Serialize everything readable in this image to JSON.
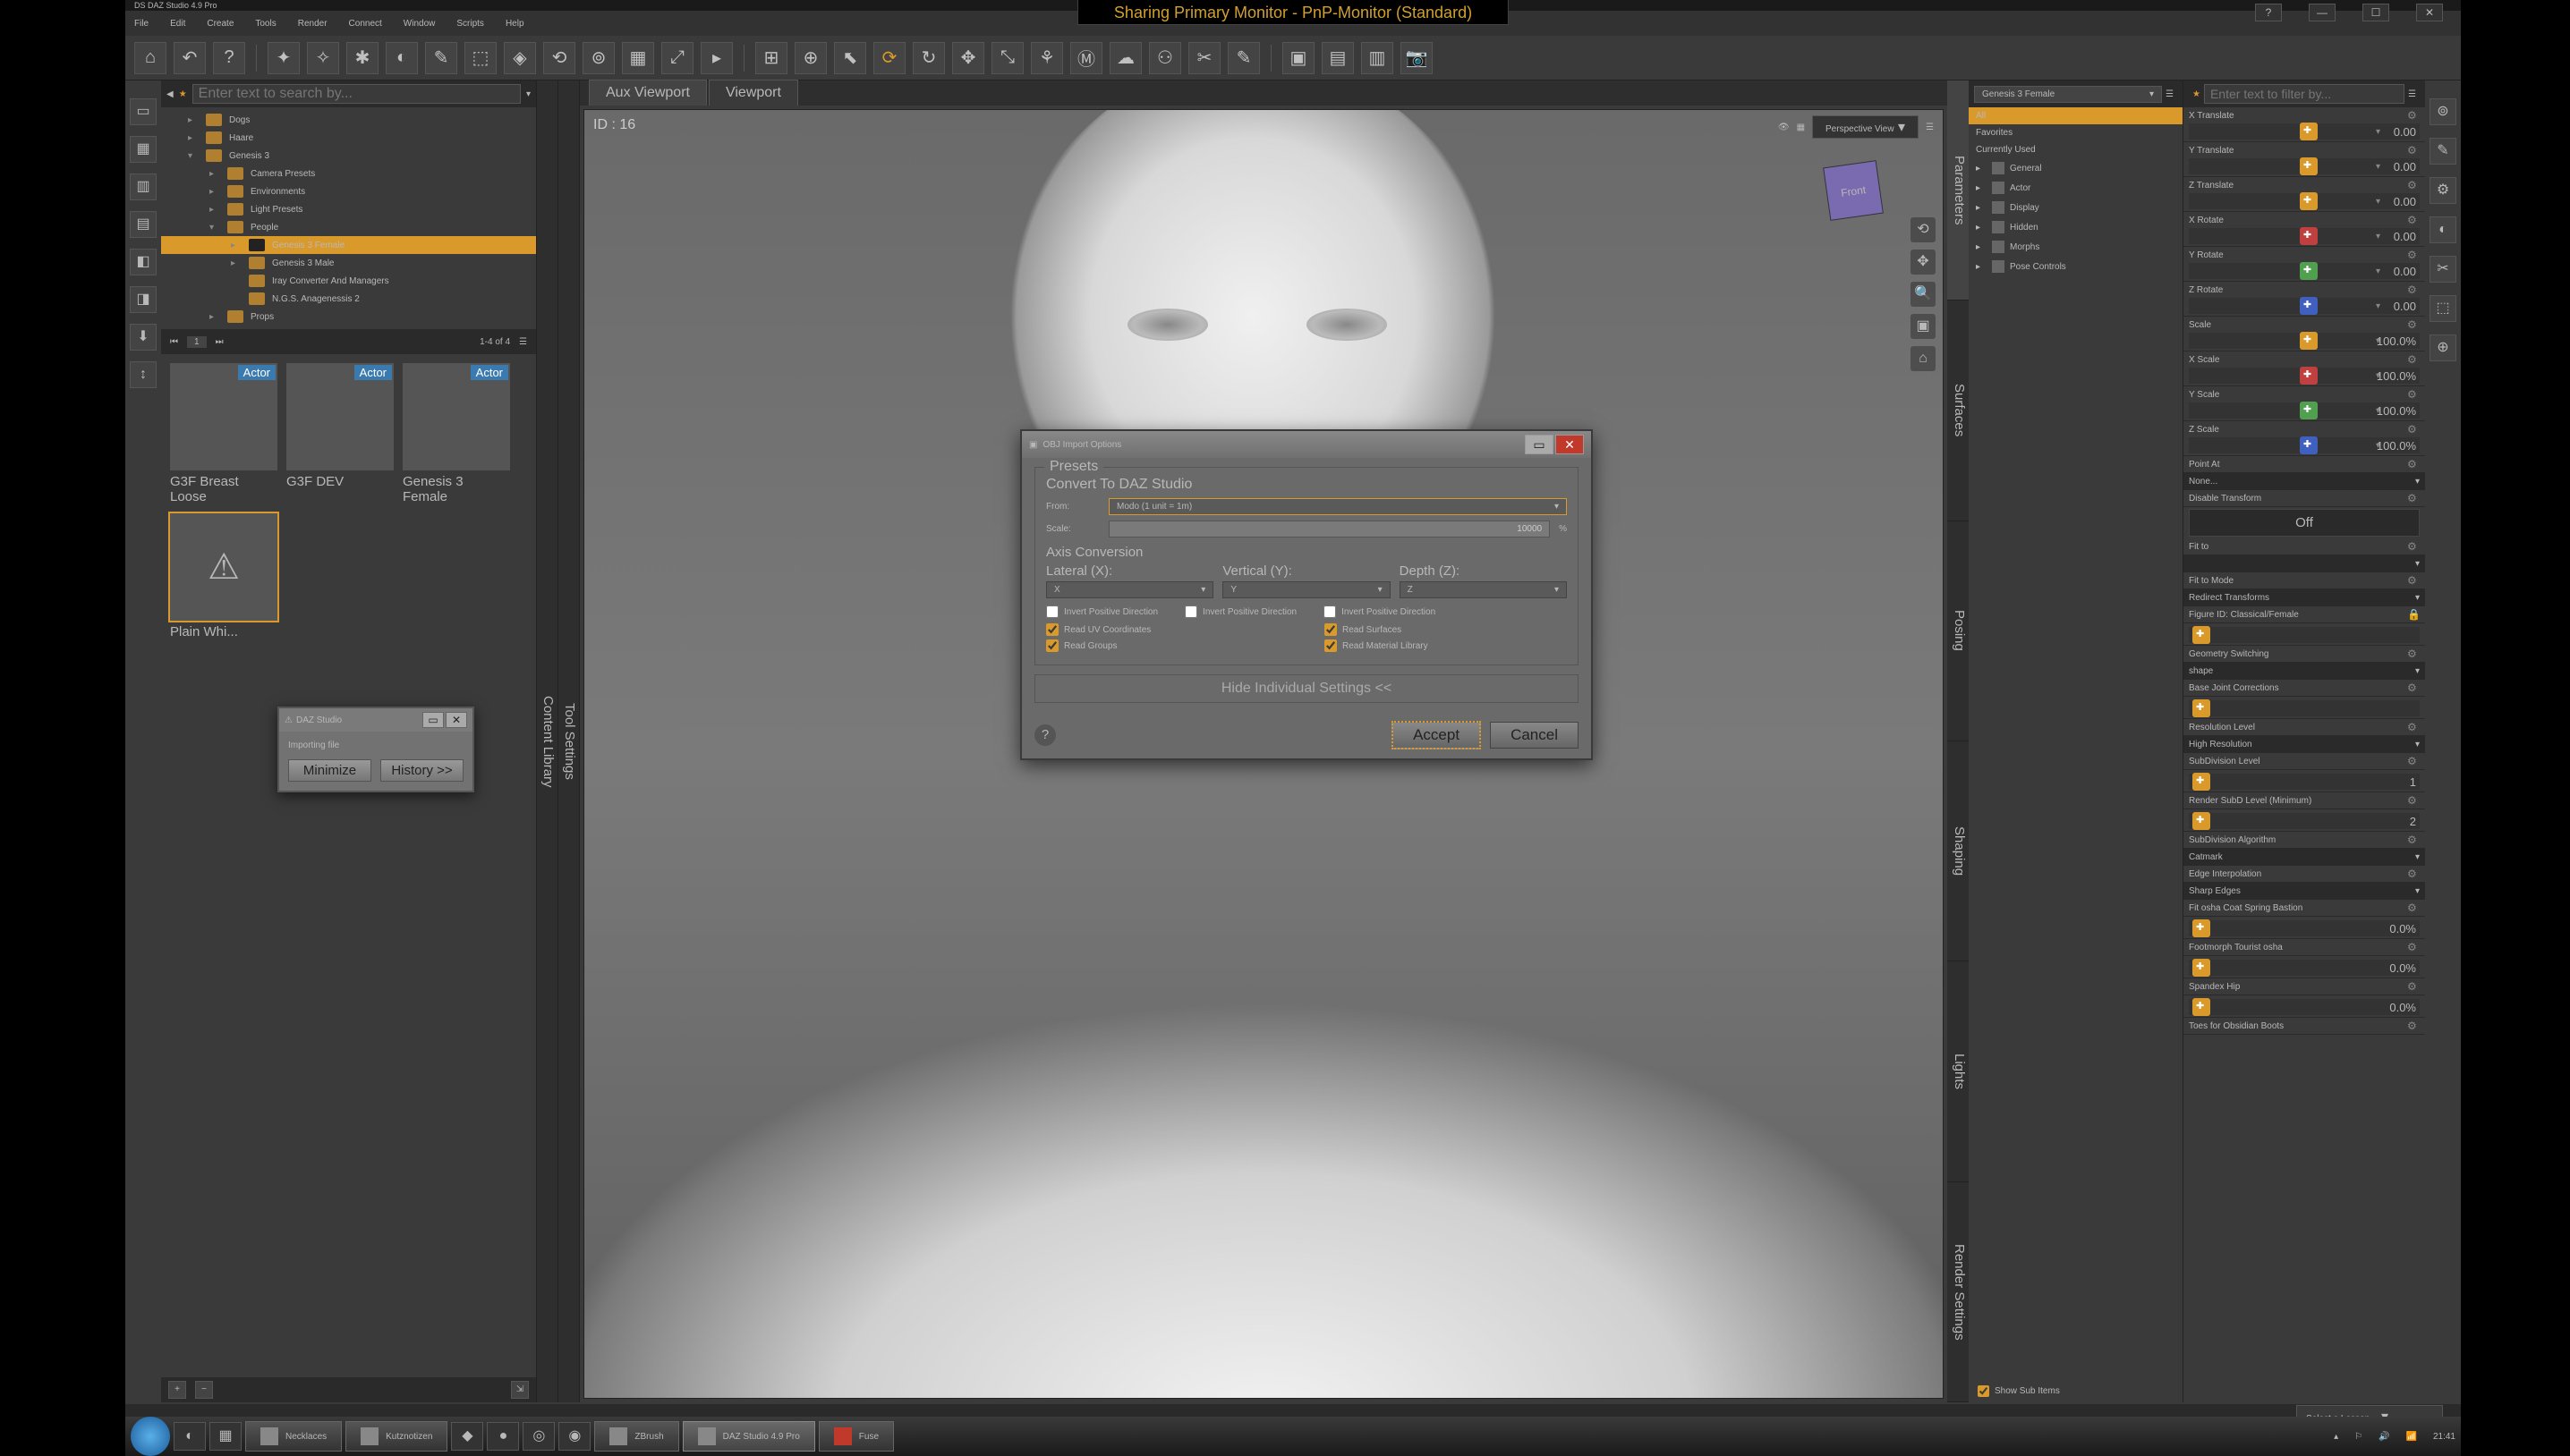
{
  "titlebar": "DS  DAZ Studio 4.9 Pro",
  "share_banner": "Sharing Primary Monitor - PnP-Monitor (Standard)",
  "menu": [
    "File",
    "Edit",
    "Create",
    "Tools",
    "Render",
    "Connect",
    "Window",
    "Scripts",
    "Help"
  ],
  "content": {
    "filter_placeholder": "Enter text to search by...",
    "tree": [
      {
        "label": "Dogs",
        "ind": 1,
        "arr": "▸"
      },
      {
        "label": "Haare",
        "ind": 1,
        "arr": "▸"
      },
      {
        "label": "Genesis 3",
        "ind": 1,
        "arr": "▾"
      },
      {
        "label": "Camera Presets",
        "ind": 2,
        "arr": "▸"
      },
      {
        "label": "Environments",
        "ind": 2,
        "arr": "▸"
      },
      {
        "label": "Light Presets",
        "ind": 2,
        "arr": "▸"
      },
      {
        "label": "People",
        "ind": 2,
        "arr": "▾"
      },
      {
        "label": "Genesis 3 Female",
        "ind": 3,
        "arr": "▸",
        "sel": true
      },
      {
        "label": "Genesis 3 Male",
        "ind": 3,
        "arr": "▸"
      },
      {
        "label": "Iray Converter And Managers",
        "ind": 3,
        "arr": ""
      },
      {
        "label": "N.G.S. Anagenessis 2",
        "ind": 3,
        "arr": ""
      },
      {
        "label": "Props",
        "ind": 2,
        "arr": "▸"
      }
    ],
    "thumbs_count": "1-4 of 4",
    "thumbs": [
      {
        "label": "G3F Breast Loose",
        "badge": "Actor"
      },
      {
        "label": "G3F DEV",
        "badge": "Actor"
      },
      {
        "label": "Genesis 3 Female",
        "badge": "Actor"
      },
      {
        "label": "Plain Whi...",
        "badge": "",
        "sel": true,
        "warn": true
      }
    ]
  },
  "side_tabs_left": [
    "Content Library",
    "Tool Settings",
    "Parameters"
  ],
  "viewport": {
    "tabs": [
      "Aux Viewport",
      "Viewport"
    ],
    "active_tab": 1,
    "hud_tl": "ID : 16",
    "camera_label": "Perspective View",
    "cube": "Front"
  },
  "side_tabs_right": [
    "Parameters",
    "Surfaces",
    "Posing",
    "Shaping",
    "Lights",
    "Render Settings"
  ],
  "scene": {
    "dropdown": "Genesis 3 Female",
    "rows": [
      {
        "label": "All",
        "hdr": true
      },
      {
        "label": "Favorites"
      },
      {
        "label": "Currently Used"
      },
      {
        "label": "General",
        "ico": "G"
      },
      {
        "label": "Actor",
        "ico": "👤"
      },
      {
        "label": "Display",
        "ico": "D"
      },
      {
        "label": "Hidden",
        "ico": "H"
      },
      {
        "label": "Morphs",
        "ico": "M"
      },
      {
        "label": "Pose Controls",
        "ico": "P"
      }
    ],
    "show_sub": "Show Sub Items"
  },
  "params": {
    "filter_placeholder": "Enter text to filter by...",
    "sliders": [
      {
        "label": "X Translate",
        "val": "0.00",
        "cls": ""
      },
      {
        "label": "Y Translate",
        "val": "0.00",
        "cls": ""
      },
      {
        "label": "Z Translate",
        "val": "0.00",
        "cls": ""
      },
      {
        "label": "X Rotate",
        "val": "0.00",
        "cls": "red"
      },
      {
        "label": "Y Rotate",
        "val": "0.00",
        "cls": "green"
      },
      {
        "label": "Z Rotate",
        "val": "0.00",
        "cls": "blue"
      },
      {
        "label": "Scale",
        "val": "100.0%",
        "cls": ""
      },
      {
        "label": "X Scale",
        "val": "100.0%",
        "cls": "red"
      },
      {
        "label": "Y Scale",
        "val": "100.0%",
        "cls": "green"
      },
      {
        "label": "Z Scale",
        "val": "100.0%",
        "cls": "blue"
      }
    ],
    "sections": [
      {
        "type": "label",
        "text": "Point At"
      },
      {
        "type": "drop",
        "text": "None..."
      },
      {
        "type": "label",
        "text": "Disable Transform",
        "dim": true
      },
      {
        "type": "toggle",
        "text": "Off"
      },
      {
        "type": "label",
        "text": "Fit to"
      },
      {
        "type": "drop",
        "text": ""
      },
      {
        "type": "label",
        "text": "Fit to Mode"
      },
      {
        "type": "drop",
        "text": "Redirect Transforms"
      },
      {
        "type": "label",
        "text": "Figure ID: Classical/Female",
        "dim": true,
        "lock": true
      },
      {
        "type": "slider",
        "text": "",
        "val": ""
      },
      {
        "type": "label",
        "text": "Geometry Switching",
        "dim": true
      },
      {
        "type": "drop",
        "text": "shape"
      },
      {
        "type": "label",
        "text": "Base Joint Corrections"
      },
      {
        "type": "slider",
        "text": "",
        "val": ""
      },
      {
        "type": "label",
        "text": "Resolution Level"
      },
      {
        "type": "drop",
        "text": "High Resolution"
      },
      {
        "type": "label",
        "text": "SubDivision Level"
      },
      {
        "type": "slider",
        "text": "",
        "val": "1"
      },
      {
        "type": "label",
        "text": "Render SubD Level (Minimum)"
      },
      {
        "type": "slider",
        "text": "",
        "val": "2"
      },
      {
        "type": "label",
        "text": "SubDivision Algorithm"
      },
      {
        "type": "drop",
        "text": "Catmark"
      },
      {
        "type": "label",
        "text": "Edge Interpolation"
      },
      {
        "type": "drop",
        "text": "Sharp Edges"
      },
      {
        "type": "label",
        "text": "Fit osha Coat Spring Bastion"
      },
      {
        "type": "slider",
        "text": "",
        "val": "0.0%"
      },
      {
        "type": "label",
        "text": "Footmorph Tourist osha"
      },
      {
        "type": "slider",
        "text": "",
        "val": "0.0%"
      },
      {
        "type": "label",
        "text": "Spandex Hip"
      },
      {
        "type": "slider",
        "text": "",
        "val": "0.0%"
      },
      {
        "type": "label",
        "text": "Toes for Obsidian Boots"
      }
    ]
  },
  "dialog": {
    "title": "OBJ Import Options",
    "group1": "Presets",
    "convert_label": "Convert To DAZ Studio",
    "from_label": "From:",
    "from_value": "Modo (1 unit = 1m)",
    "scale_label": "Scale:",
    "scale_value": "10000",
    "scale_unit": "%",
    "axis_label": "Axis Conversion",
    "axes": [
      {
        "lbl": "Lateral (X):",
        "val": "X"
      },
      {
        "lbl": "Vertical (Y):",
        "val": "Y"
      },
      {
        "lbl": "Depth (Z):",
        "val": "Z"
      }
    ],
    "invert": "Invert Positive Direction",
    "checks": [
      {
        "label": "Read UV Coordinates",
        "on": true
      },
      {
        "label": "Read Surfaces",
        "on": true
      },
      {
        "label": "Read Groups",
        "on": true
      },
      {
        "label": "Read Material Library",
        "on": true
      }
    ],
    "hide_link": "Hide Individual Settings <<",
    "accept": "Accept",
    "cancel": "Cancel"
  },
  "progress": {
    "title": "DAZ Studio",
    "msg": "Importing file",
    "minimize": "Minimize",
    "history": "History >>"
  },
  "lesson": "Select a Lesson...",
  "taskbar": {
    "items": [
      {
        "label": "Necklaces"
      },
      {
        "label": "Kutznotizen"
      },
      {
        "label": "ZBrush"
      },
      {
        "label": "DAZ Studio 4.9 Pro",
        "active": true
      },
      {
        "label": "Fuse"
      }
    ],
    "time": "21:41",
    "date": ""
  }
}
